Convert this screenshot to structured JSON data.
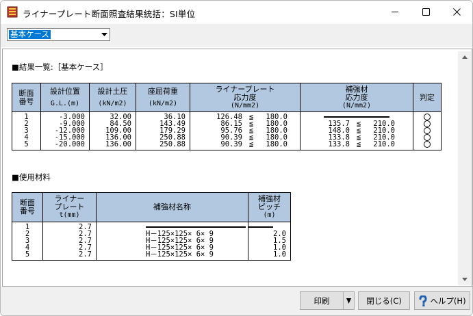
{
  "window": {
    "title": "ライナープレート断面照査結果統括：SI単位",
    "minimize": "─",
    "maximize": "☐",
    "close": "✕"
  },
  "toolbar": {
    "case_select": {
      "value": "基本ケース"
    }
  },
  "results": {
    "heading": "■結果一覧:［基本ケース］",
    "headers": {
      "section_no": [
        "断面",
        "番号"
      ],
      "design_position": "設計位置",
      "design_position_unit": "G.L.(m)",
      "earth_pressure": "設計土圧",
      "earth_pressure_unit": "(kN/m2)",
      "buckling_load": "座屈荷重",
      "buckling_load_unit": "(kN/m2)",
      "liner_plate": "ライナープレート",
      "liner_stress": "応力度",
      "liner_unit": "(N/mm2)",
      "reinforcement": "補強材",
      "reinforcement_stress": "応力度",
      "reinforcement_unit": "(N/mm2)",
      "judgement": "判定"
    },
    "rows": [
      {
        "no": "1",
        "position": "-3.000",
        "pressure": "32.00",
        "buckling": "36.10",
        "liner": "126.48",
        "liner_sym": "≦",
        "liner_allow": "180.0",
        "reinf": null,
        "reinf_sym": "",
        "reinf_allow": "",
        "judge": "○"
      },
      {
        "no": "2",
        "position": "-9.000",
        "pressure": "84.50",
        "buckling": "143.49",
        "liner": "86.15",
        "liner_sym": "≦",
        "liner_allow": "180.0",
        "reinf": "135.7",
        "reinf_sym": "≦",
        "reinf_allow": "210.0",
        "judge": "○"
      },
      {
        "no": "3",
        "position": "-12.000",
        "pressure": "109.00",
        "buckling": "179.29",
        "liner": "95.76",
        "liner_sym": "≦",
        "liner_allow": "180.0",
        "reinf": "148.0",
        "reinf_sym": "≦",
        "reinf_allow": "210.0",
        "judge": "○"
      },
      {
        "no": "4",
        "position": "-15.000",
        "pressure": "136.00",
        "buckling": "250.88",
        "liner": "90.39",
        "liner_sym": "≦",
        "liner_allow": "180.0",
        "reinf": "133.8",
        "reinf_sym": "≦",
        "reinf_allow": "210.0",
        "judge": "○"
      },
      {
        "no": "5",
        "position": "-20.000",
        "pressure": "136.00",
        "buckling": "250.88",
        "liner": "90.39",
        "liner_sym": "≦",
        "liner_allow": "180.0",
        "reinf": "133.8",
        "reinf_sym": "≦",
        "reinf_allow": "210.0",
        "judge": "○"
      }
    ]
  },
  "materials": {
    "heading": "■使用材料",
    "headers": {
      "section_no": [
        "断面",
        "番号"
      ],
      "liner_plate": [
        "ライナー",
        "プレート"
      ],
      "thickness_unit": "t(mm)",
      "reinforcement_name": "補強材名称",
      "pitch": [
        "補強材",
        "ピッチ"
      ],
      "pitch_unit": "(m)"
    },
    "rows": [
      {
        "no": "1",
        "t": "2.7",
        "name": null,
        "pitch": null
      },
      {
        "no": "2",
        "t": "2.7",
        "name": "H－125×125× 6× 9",
        "pitch": "2.0"
      },
      {
        "no": "3",
        "t": "2.7",
        "name": "H－125×125× 6× 9",
        "pitch": "1.5"
      },
      {
        "no": "4",
        "t": "2.7",
        "name": "H－125×125× 6× 9",
        "pitch": "1.0"
      },
      {
        "no": "5",
        "t": "2.7",
        "name": "H－125×125× 6× 9",
        "pitch": "1.0"
      }
    ]
  },
  "footer": {
    "print": "印刷",
    "close": "閉じる(C)",
    "help": "ヘルプ(H)"
  },
  "colors": {
    "header_bg": "#b2c8e0",
    "select_highlight": "#0078d7",
    "help_icon": "#1a5fb4"
  }
}
